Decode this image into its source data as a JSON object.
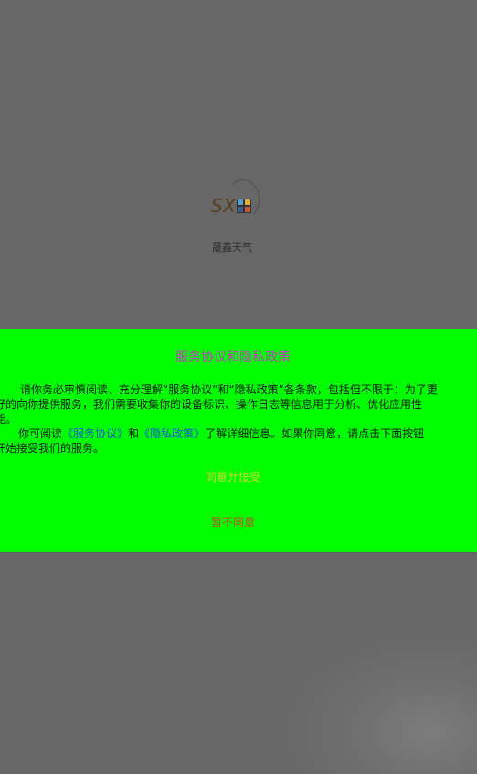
{
  "splash": {
    "logo_text": "SX",
    "app_name": "晟鑫天气"
  },
  "dialog": {
    "title": "服务协议和隐私政策",
    "body_lines": [
      "请你务必审慎阅读、充分理解“服务协议”和“隐私政策”各条款，包括但不限于：为了更",
      "好的向你提供服务，我们需要收集你的设备标识、操作日志等信息用于分析、优化应用性",
      "能。"
    ],
    "read_prefix": "你可阅读",
    "service_link": "《服务协议》",
    "and": "和",
    "privacy_link": "《隐私政策》",
    "read_suffix": "了解详细信息。如果你同意，请点击下面按钮",
    "last_line": "开始接受我们的服务。",
    "agree_label": "同意并接受",
    "decline_label": "暂不同意"
  },
  "colors": {
    "backdrop": "#676767",
    "dialog_bg": "#00ff00",
    "title": "#cc33cc",
    "link": "#1a4fd6",
    "agree": "#cddc39",
    "decline": "#c8442a"
  },
  "icons": [
    "app-logo-icon"
  ]
}
